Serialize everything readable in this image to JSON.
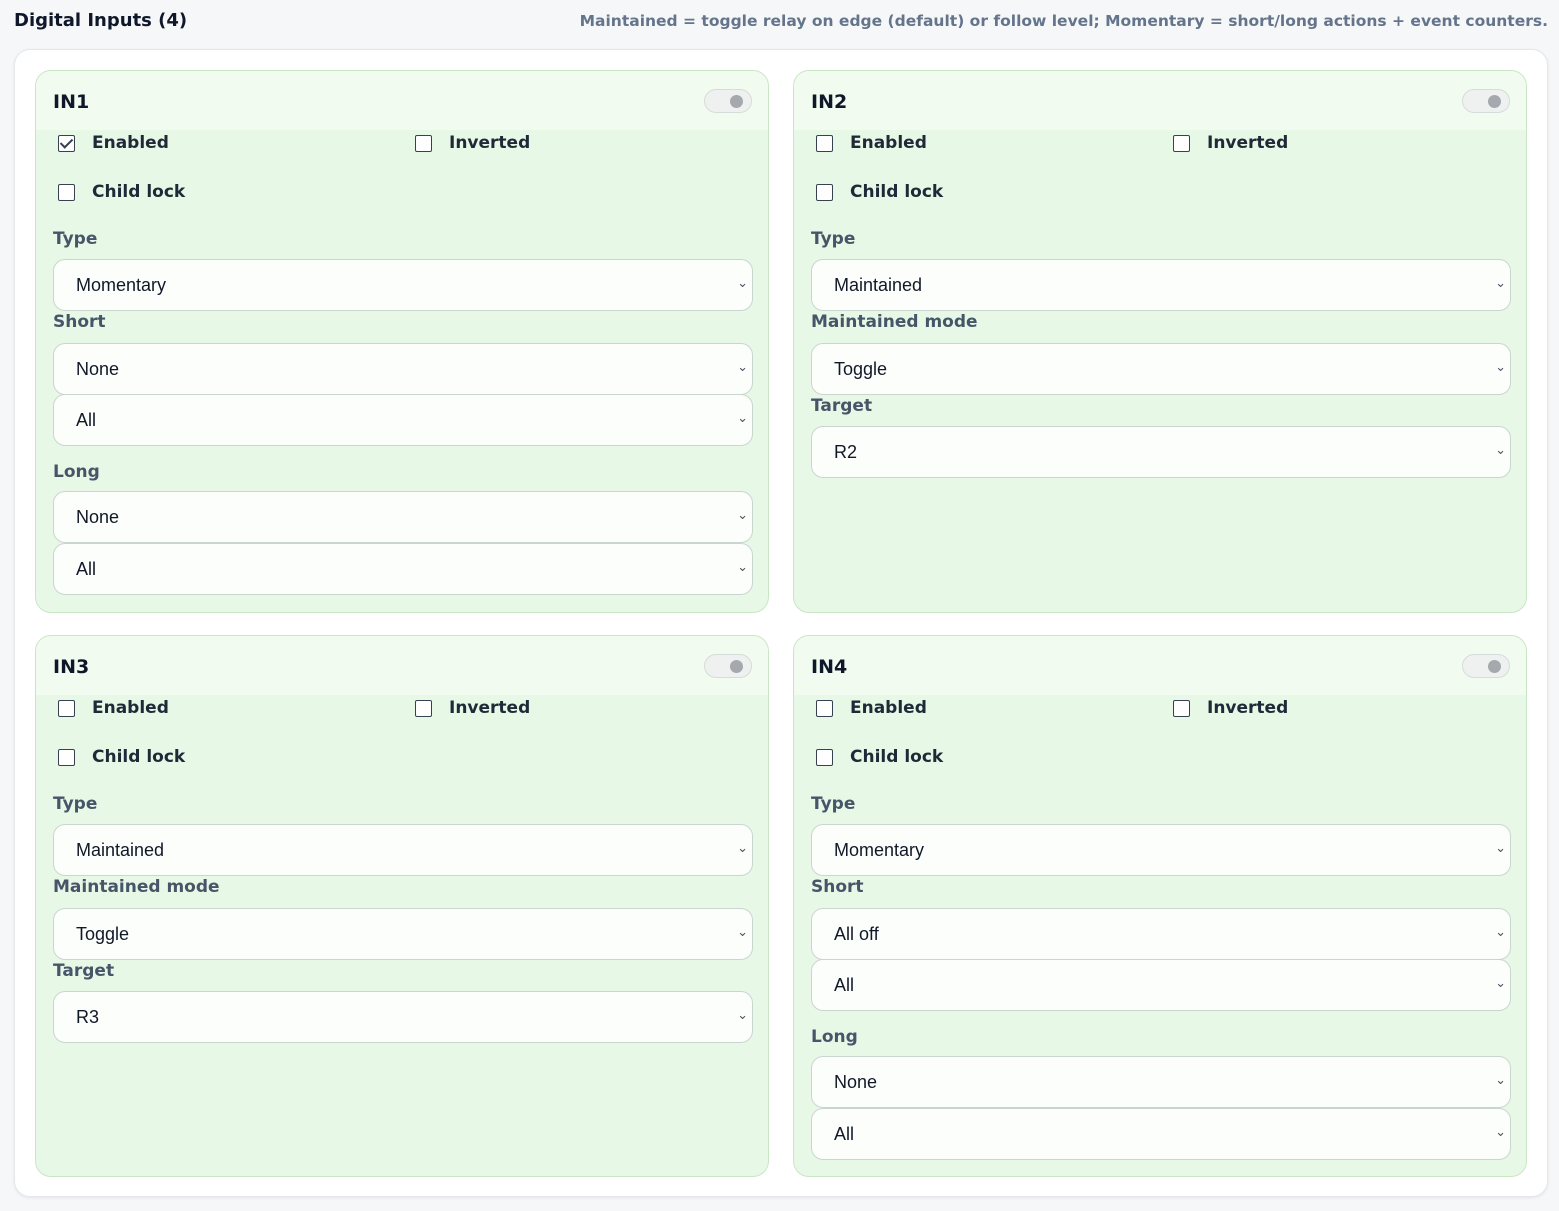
{
  "header": {
    "title": "Digital Inputs (4)",
    "hint": "Maintained = toggle relay on edge (default) or follow level; Momentary = short/long actions + event counters."
  },
  "inputs": [
    {
      "name": "IN1",
      "power_on": false,
      "enabled": {
        "label": "Enabled",
        "checked": true
      },
      "inverted": {
        "label": "Inverted",
        "checked": false
      },
      "child_lock": {
        "label": "Child lock",
        "checked": false
      },
      "type_label": "Type",
      "type_value": "Momentary",
      "short_label": "Short",
      "short_action": "None",
      "short_target": "All",
      "long_label": "Long",
      "long_action": "None",
      "long_target": "All"
    },
    {
      "name": "IN2",
      "power_on": false,
      "enabled": {
        "label": "Enabled",
        "checked": false
      },
      "inverted": {
        "label": "Inverted",
        "checked": false
      },
      "child_lock": {
        "label": "Child lock",
        "checked": false
      },
      "type_label": "Type",
      "type_value": "Maintained",
      "mode_label": "Maintained mode",
      "mode_value": "Toggle",
      "target_label": "Target",
      "target_value": "R2"
    },
    {
      "name": "IN3",
      "power_on": false,
      "enabled": {
        "label": "Enabled",
        "checked": false
      },
      "inverted": {
        "label": "Inverted",
        "checked": false
      },
      "child_lock": {
        "label": "Child lock",
        "checked": false
      },
      "type_label": "Type",
      "type_value": "Maintained",
      "mode_label": "Maintained mode",
      "mode_value": "Toggle",
      "target_label": "Target",
      "target_value": "R3"
    },
    {
      "name": "IN4",
      "power_on": false,
      "enabled": {
        "label": "Enabled",
        "checked": false
      },
      "inverted": {
        "label": "Inverted",
        "checked": false
      },
      "child_lock": {
        "label": "Child lock",
        "checked": false
      },
      "type_label": "Type",
      "type_value": "Momentary",
      "short_label": "Short",
      "short_action": "All off",
      "short_target": "All",
      "long_label": "Long",
      "long_action": "None",
      "long_target": "All"
    }
  ],
  "colors": {
    "card_bg": "#e8f8e6",
    "card_border": "#c9e6c4",
    "label_text": "#475569",
    "hint_text": "#64748b"
  },
  "icons": {
    "select_chevron": "chevron-down-icon",
    "checkbox_mark": "check-icon",
    "toggle_knob": "toggle-knob-icon"
  }
}
